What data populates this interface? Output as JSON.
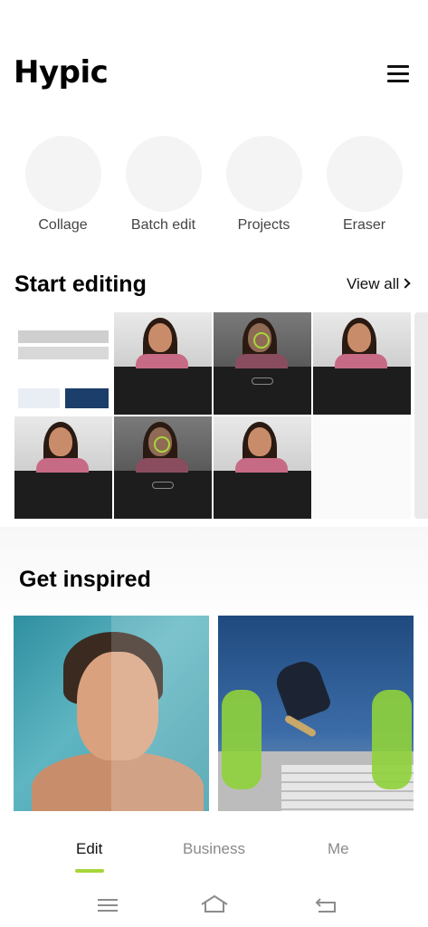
{
  "header": {
    "logo": "Hypic",
    "menu_icon": "hamburger-icon"
  },
  "tools": [
    {
      "label": "Collage"
    },
    {
      "label": "Batch edit"
    },
    {
      "label": "Projects"
    },
    {
      "label": "Eraser"
    }
  ],
  "start_editing": {
    "title": "Start editing",
    "view_all": "View all"
  },
  "get_inspired": {
    "title": "Get inspired"
  },
  "bottom_nav": {
    "edit": "Edit",
    "business": "Business",
    "me": "Me"
  },
  "colors": {
    "accent": "#a7d63a",
    "tool_circle": "#f4f4f4",
    "text": "#111111",
    "muted": "#8a8a8a"
  }
}
